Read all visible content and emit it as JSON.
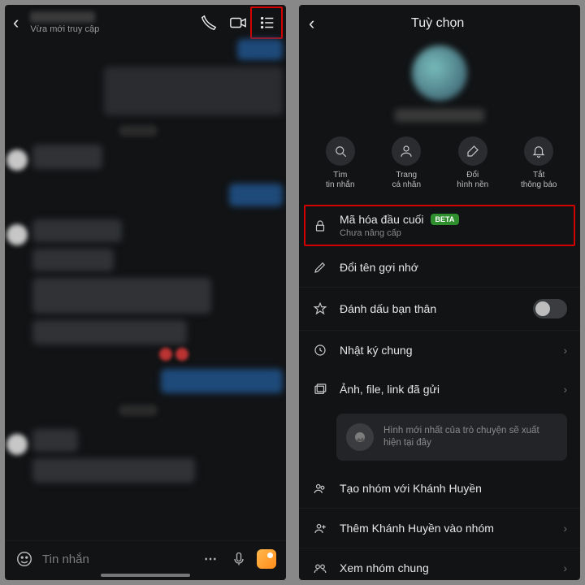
{
  "left": {
    "status": "Vừa mới truy cập",
    "input_placeholder": "Tin nhắn"
  },
  "right": {
    "header_title": "Tuỳ chọn",
    "quick": [
      {
        "label": "Tìm\ntin nhắn"
      },
      {
        "label": "Trang\ncá nhân"
      },
      {
        "label": "Đổi\nhình nền"
      },
      {
        "label": "Tắt\nthông báo"
      }
    ],
    "e2e": {
      "title": "Mã hóa đầu cuối",
      "badge": "BETA",
      "sub": "Chưa nâng cấp"
    },
    "rename": "Đổi tên gợi nhớ",
    "bestfriend": "Đánh dấu bạn thân",
    "diary": "Nhật ký chung",
    "media": "Ảnh, file, link đã gửi",
    "media_tip": "Hình mới nhất của trò chuyện sẽ xuất hiện tại đây",
    "create_group": "Tạo nhóm với Khánh Huyền",
    "add_to_group": "Thêm Khánh Huyền vào nhóm",
    "view_groups": "Xem nhóm chung"
  }
}
